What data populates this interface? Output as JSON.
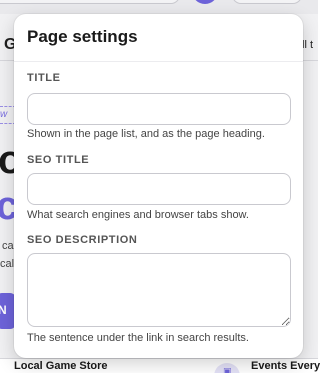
{
  "background": {
    "left_heading_fragment": "G",
    "right_link_fragment": "ll t",
    "badge_fragment": "w",
    "hero_line1_fragment": "o",
    "hero_line2_fragment": "ca",
    "subtext_line1_fragment": "ca",
    "subtext_line2_fragment": "cal",
    "cta_fragment": "N",
    "bottom_card_left_title": "Local Game Store",
    "bottom_card_right_title": "Events Every",
    "calendar_icon": "calendar-icon",
    "accent_color": "#6d63d9"
  },
  "panel": {
    "title": "Page settings",
    "fields": [
      {
        "label": "TITLE",
        "value": "",
        "placeholder": "",
        "help": "Shown in the page list, and as the page heading."
      },
      {
        "label": "SEO TITLE",
        "value": "",
        "placeholder": "",
        "help": "What search engines and browser tabs show."
      },
      {
        "label": "SEO DESCRIPTION",
        "value": "",
        "placeholder": "",
        "help": "The sentence under the link in search results."
      }
    ]
  }
}
